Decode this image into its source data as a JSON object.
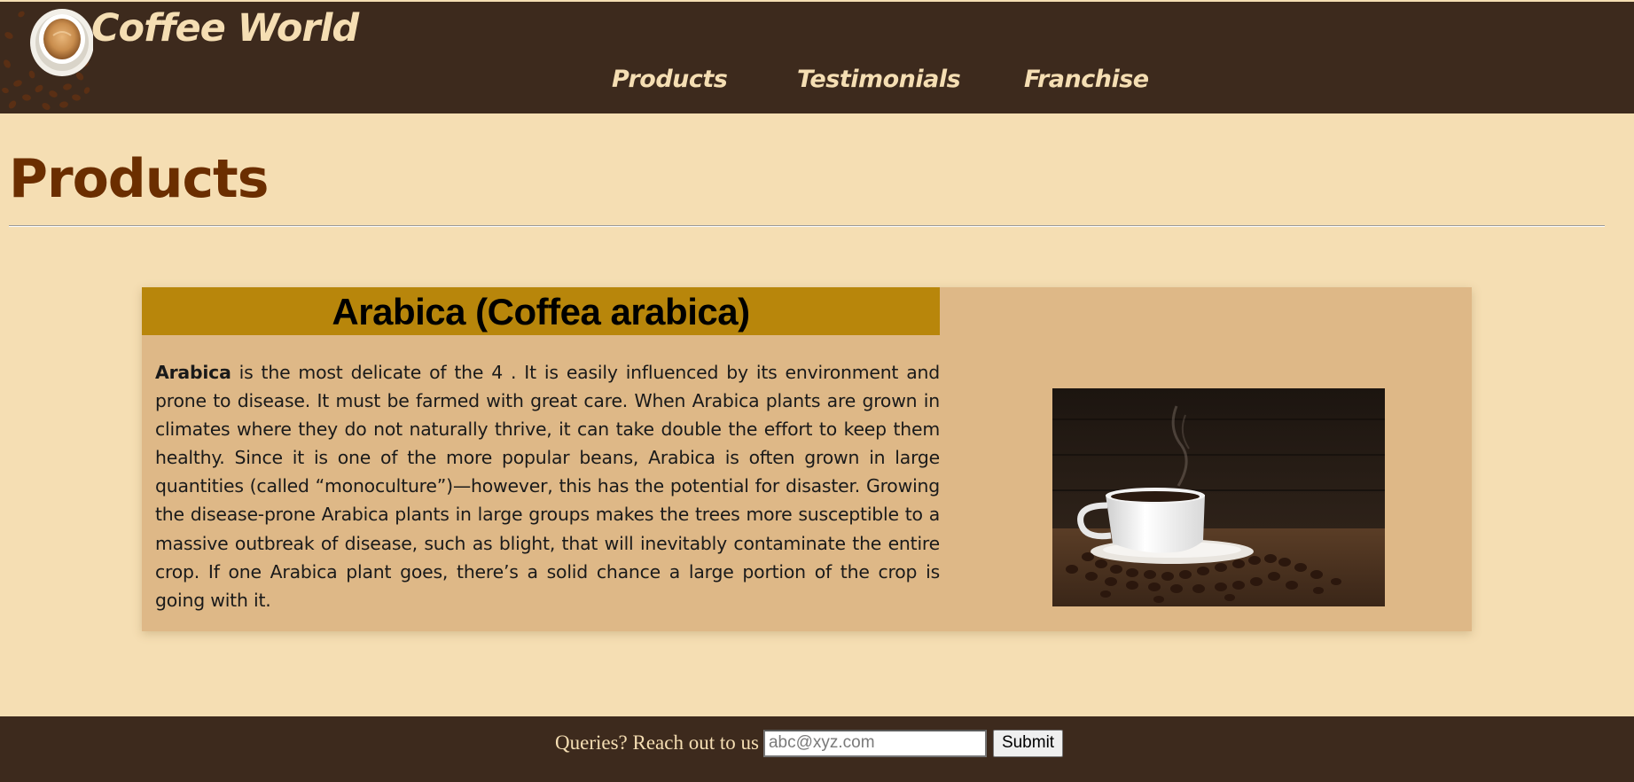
{
  "header": {
    "brand": "Coffee World",
    "logo_icon": "coffee-cup-beans-logo",
    "nav": [
      {
        "label": "Products"
      },
      {
        "label": "Testimonials"
      },
      {
        "label": "Franchise"
      }
    ]
  },
  "main": {
    "title": "Products",
    "product": {
      "heading": "Arabica (Coffea arabica)",
      "name_bold": "Arabica",
      "description": " is the most delicate of the 4 . It is easily influenced by its environment and prone to disease. It must be farmed with great care. When Arabica plants are grown in climates where they do not naturally thrive, it can take double the effort to keep them healthy. Since it is one of the more popular beans, Arabica is often grown in large quantities (called “monoculture”)—however, this has the potential for disaster. Growing the disease-prone Arabica plants in large groups makes the trees more susceptible to a massive outbreak of disease, such as blight, that will inevitably contaminate the entire crop. If one Arabica plant goes, there’s a solid chance a large portion of the crop is going with it.",
      "image_icon": "coffee-cup-photo"
    }
  },
  "footer": {
    "label": "Queries? Reach out to us",
    "email_placeholder": "abc@xyz.com",
    "email_value": "",
    "submit_label": "Submit"
  },
  "colors": {
    "page_bg": "#f5deb3",
    "header_bg": "#3d2a1d",
    "accent_text": "#f5deb3",
    "title": "#6b2e00",
    "card_bg": "#deb887",
    "card_heading_bg": "#b8860b"
  }
}
